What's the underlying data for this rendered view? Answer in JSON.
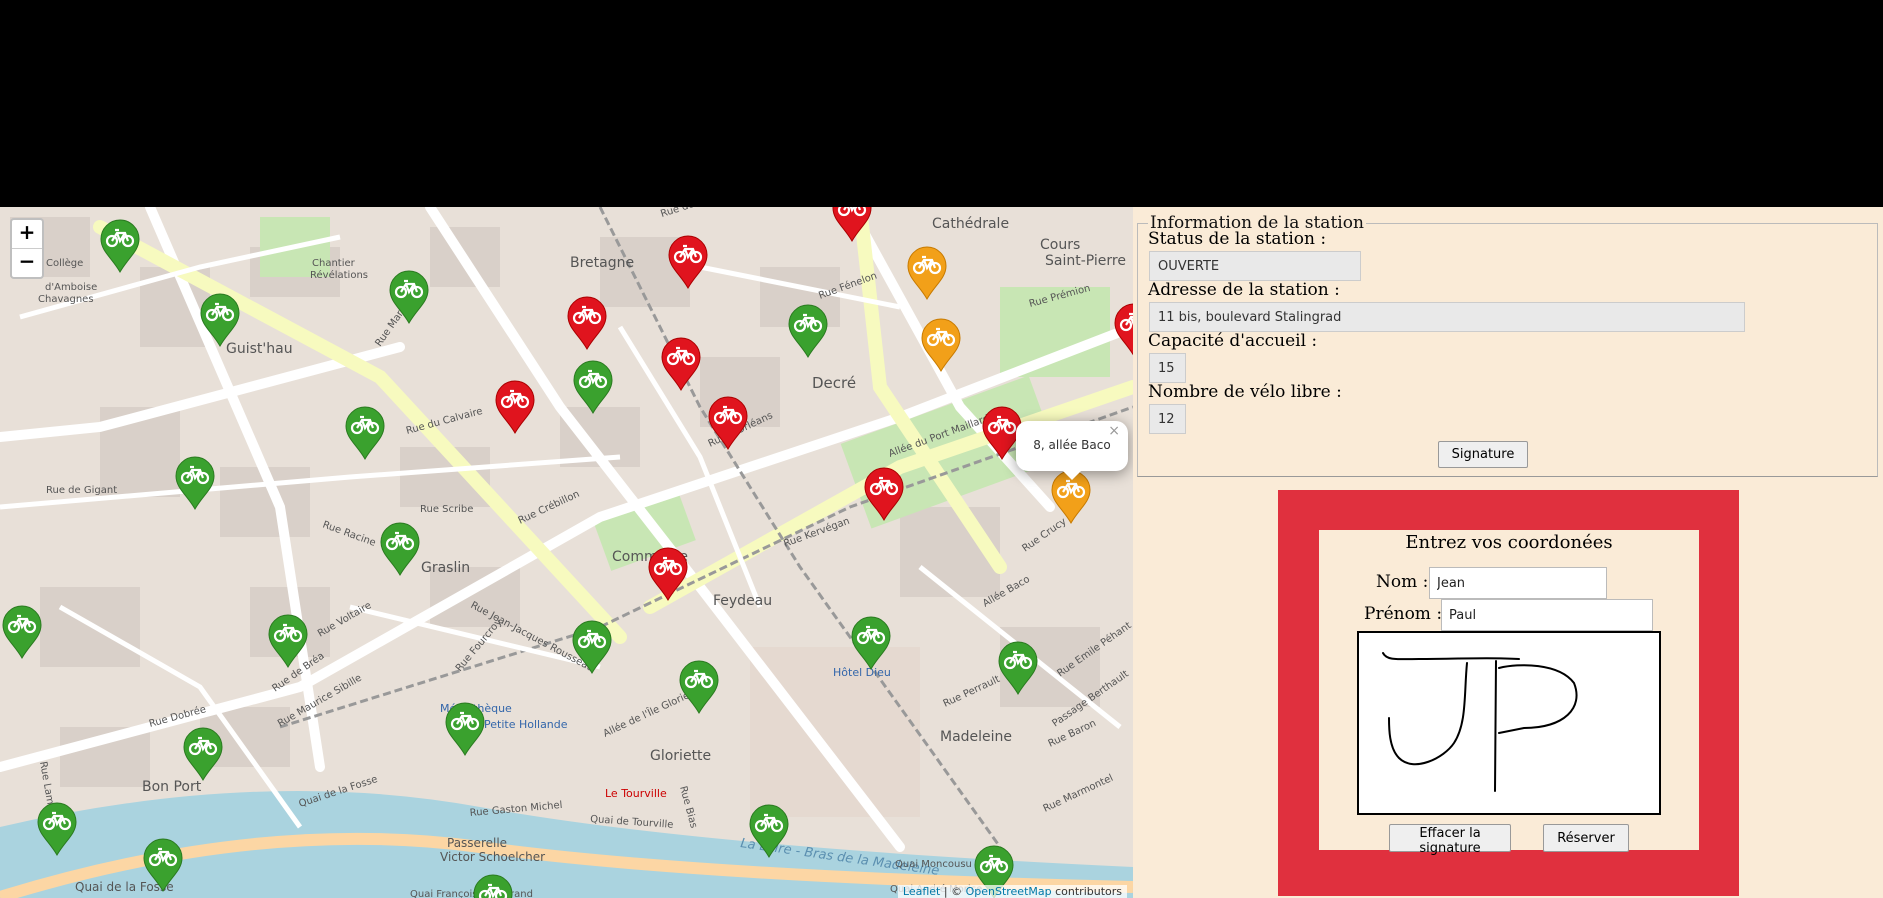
{
  "map": {
    "zoom_in": "+",
    "zoom_out": "−",
    "attribution_leaflet": "Leaflet",
    "attribution_sep": " | © ",
    "attribution_osm": "OpenStreetMap",
    "attribution_tail": " contributors",
    "popup": {
      "text": "8, allée Baco",
      "close": "×"
    },
    "marker_colors": {
      "available": "#3aa12e",
      "empty": "#e0141e",
      "low": "#f2a019"
    },
    "marker_icon": "bicycle-icon",
    "place_labels": [
      "Bretagne",
      "Decré",
      "Cathédrale",
      "Cours Saint-Pierre",
      "Guist'hau",
      "Graslin",
      "Commerce",
      "Feydeau",
      "Gloriette",
      "Hôtel Dieu",
      "Madeleine",
      "Bon Port",
      "Chantier Révélations",
      "Collège privé Françoise d'Amboise Chavagnes",
      "Le Tourville",
      "Passerelle Victor Schoelcher",
      "Médiathèque",
      "Petite Hollande",
      "Quai de la Fosse",
      "Quai de Tourville",
      "Quai Moncousu",
      "Quai André Morice",
      "La Loire - Bras de la Madeleine",
      "Allée du Port Maillard",
      "Rue de Gigant",
      "Rue du Calvaire",
      "Rue Crébillon",
      "Rue Scribe",
      "Rue Gaston Michel",
      "Rue Kervégan",
      "Rue des Halles",
      "Rue d'Orléans",
      "Rue Marceau",
      "Rue Racine",
      "Rue Voltaire",
      "Rue Jean-Jacques Rousseau",
      "Rue Fourcroy",
      "Rue Maurice Sibille",
      "Rue de Bréa",
      "Rue Dobrée",
      "Rue Lamoricière",
      "Rue Fénelon",
      "Rue Prémion",
      "Allée Baco",
      "Rue Emile Péhant",
      "Passage Berthault",
      "Rue Perrault",
      "Rue Baron",
      "Rue Marmontel",
      "Rue Crucy",
      "Allée de l'Île Gloriette",
      "Rue Bias",
      "Quai François Mitterrand"
    ]
  },
  "station": {
    "legend": "Information de la station",
    "status_label": "Status de la station :",
    "status_value": "OUVERTE",
    "address_label": "Adresse de la station :",
    "address_value": "11 bis, boulevard Stalingrad",
    "capacity_label": "Capacité d'accueil :",
    "capacity_value": "15",
    "bikes_label": "Nombre de vélo libre :",
    "bikes_value": "12",
    "signature_button": "Signature"
  },
  "reservation": {
    "title": "Entrez vos coordonées",
    "nom_label": "Nom :",
    "nom_value": "Jean",
    "prenom_label": "Prénom :",
    "prenom_value": "Paul",
    "clear_button": "Effacer la signature",
    "reserve_button": "Réserver",
    "frame_color": "#e0303e"
  }
}
